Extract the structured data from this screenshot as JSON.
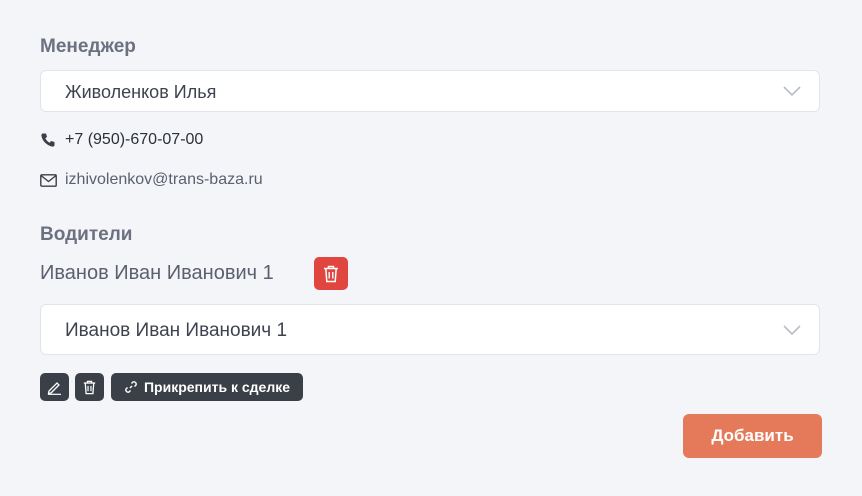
{
  "manager": {
    "title": "Менеджер",
    "selected": "Живоленков Илья",
    "phone": "+7 (950)-670-07-00",
    "email": "izhivolenkov@trans-baza.ru"
  },
  "drivers": {
    "title": "Водители",
    "current_driver": "Иванов Иван Иванович 1",
    "selected": "Иванов Иван Иванович 1",
    "attach_label": "Прикрепить к сделке"
  },
  "actions": {
    "add_label": "Добавить"
  },
  "colors": {
    "accent": "#e57a5a",
    "danger": "#e0463f",
    "dark_button": "#3a3f48"
  },
  "icons": [
    "phone-icon",
    "mail-icon",
    "chevron-down-icon",
    "trash-icon",
    "pencil-icon",
    "link-icon"
  ]
}
